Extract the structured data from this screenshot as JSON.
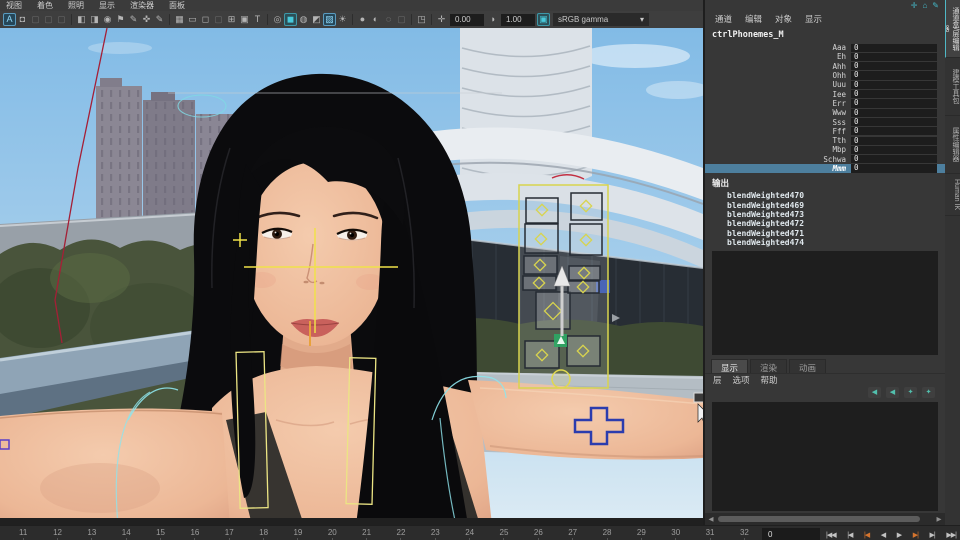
{
  "viewport_menu": {
    "items": [
      {
        "label": "视图"
      },
      {
        "label": "着色"
      },
      {
        "label": "照明"
      },
      {
        "label": "显示"
      },
      {
        "label": "渲染器"
      },
      {
        "label": "面板"
      }
    ]
  },
  "toolbar": {
    "icons": [
      {
        "name": "select-camera-icon",
        "glyph": "A",
        "active": true
      },
      {
        "name": "lock-camera-icon",
        "glyph": "◘"
      },
      {
        "name": "camera-attributes-icon",
        "glyph": "▢",
        "dim": true
      },
      {
        "name": "bookmark-slot-icon",
        "glyph": "▢",
        "dim": true
      },
      {
        "name": "image-plane-icon",
        "glyph": "▢",
        "dim": true
      },
      {
        "name": "separator",
        "glyph": "",
        "sep": true
      },
      {
        "name": "previous-view-icon",
        "glyph": "◧"
      },
      {
        "name": "next-view-icon",
        "glyph": "◨"
      },
      {
        "name": "camera-icon",
        "glyph": "◉"
      },
      {
        "name": "bookmark-icon",
        "glyph": "⚑"
      },
      {
        "name": "grease-pencil-icon",
        "glyph": "✎"
      },
      {
        "name": "rotate-view-icon",
        "glyph": "✜"
      },
      {
        "name": "draw-tool-icon",
        "glyph": "✎"
      },
      {
        "name": "separator",
        "glyph": "",
        "sep": true
      },
      {
        "name": "grid-icon",
        "glyph": "▦"
      },
      {
        "name": "film-gate-icon",
        "glyph": "▭"
      },
      {
        "name": "resolution-gate-icon",
        "glyph": "◻"
      },
      {
        "name": "gate-mask-icon",
        "glyph": "▢",
        "dim": true
      },
      {
        "name": "field-chart-icon",
        "glyph": "⊞"
      },
      {
        "name": "safe-action-icon",
        "glyph": "▣"
      },
      {
        "name": "safe-title-icon",
        "glyph": "T"
      },
      {
        "name": "separator",
        "glyph": "",
        "sep": true
      },
      {
        "name": "wireframe-icon",
        "glyph": "◎"
      },
      {
        "name": "shaded-icon",
        "glyph": "◼",
        "teal": true
      },
      {
        "name": "textured-icon",
        "glyph": "◍"
      },
      {
        "name": "use-default-material-icon",
        "glyph": "◩"
      },
      {
        "name": "xray-icon",
        "glyph": "▨",
        "active": true
      },
      {
        "name": "lighting-icon",
        "glyph": "☀"
      },
      {
        "name": "separator",
        "glyph": "",
        "sep": true
      },
      {
        "name": "shadows-icon",
        "glyph": "●"
      },
      {
        "name": "ambient-occlusion-icon",
        "glyph": "◐"
      },
      {
        "name": "motion-blur-icon",
        "glyph": "◌"
      },
      {
        "name": "plugin-slot-icon",
        "glyph": "▢",
        "dim": true
      },
      {
        "name": "separator",
        "glyph": "",
        "sep": true
      },
      {
        "name": "isolate-select-icon",
        "glyph": "◳"
      },
      {
        "name": "separator",
        "glyph": "",
        "sep": true
      },
      {
        "name": "exposure-icon",
        "glyph": "✛"
      }
    ],
    "exposure_value": "0.00",
    "gamma_icon": "◑",
    "gamma_value": "1.00",
    "view_transform_icon": "▣",
    "colorspace": "sRGB gamma",
    "dropdown_caret": "▾"
  },
  "header_icons": [
    {
      "name": "character-axis-icon",
      "glyph": "✛",
      "color": "#c65050"
    },
    {
      "name": "workspace-home-icon",
      "glyph": "⌂",
      "color": "#44b9c8"
    },
    {
      "name": "edit-mode-icon",
      "glyph": "✎",
      "color": "#44b9c8"
    }
  ],
  "channel_box": {
    "menu": [
      {
        "label": "通道"
      },
      {
        "label": "编辑"
      },
      {
        "label": "对象"
      },
      {
        "label": "显示"
      }
    ],
    "node_name": "ctrlPhonemes_M",
    "attributes": [
      {
        "name": "Aaa",
        "value": "0"
      },
      {
        "name": "Eh",
        "value": "0"
      },
      {
        "name": "Ahh",
        "value": "0"
      },
      {
        "name": "Ohh",
        "value": "0"
      },
      {
        "name": "Uuu",
        "value": "0"
      },
      {
        "name": "Iee",
        "value": "0"
      },
      {
        "name": "Err",
        "value": "0"
      },
      {
        "name": "Www",
        "value": "0"
      },
      {
        "name": "Sss",
        "value": "0"
      },
      {
        "name": "Fff",
        "value": "0"
      },
      {
        "name": "Tth",
        "value": "0"
      },
      {
        "name": "Mbp",
        "value": "0"
      },
      {
        "name": "Schwa",
        "value": "0"
      },
      {
        "name": "Mmm",
        "value": "0",
        "selected": true
      }
    ],
    "output_label": "输出",
    "outputs": [
      {
        "name": "blendWeighted470"
      },
      {
        "name": "blendWeighted469"
      },
      {
        "name": "blendWeighted473"
      },
      {
        "name": "blendWeighted472"
      },
      {
        "name": "blendWeighted471"
      },
      {
        "name": "blendWeighted474"
      }
    ]
  },
  "layer_editor": {
    "tabs": [
      {
        "label": "显示",
        "active": true
      },
      {
        "label": "渲染"
      },
      {
        "label": "动画"
      }
    ],
    "menu": [
      {
        "label": "层"
      },
      {
        "label": "选项"
      },
      {
        "label": "帮助"
      }
    ],
    "icon_buttons": [
      {
        "name": "layer-move-icon-1",
        "glyph": "◀"
      },
      {
        "name": "layer-move-icon-2",
        "glyph": "◀"
      },
      {
        "name": "layer-paint-icon",
        "glyph": "✦"
      },
      {
        "name": "layer-new-icon",
        "glyph": "✦"
      }
    ]
  },
  "sidebar_tabs": [
    {
      "label": "通道盒/层编辑器",
      "active": true
    },
    {
      "label": "建模工具包"
    },
    {
      "label": "属性编辑器"
    },
    {
      "label": "Human IK"
    }
  ],
  "timeline": {
    "frames": [
      {
        "n": "11"
      },
      {
        "n": "12"
      },
      {
        "n": "13"
      },
      {
        "n": "14"
      },
      {
        "n": "15"
      },
      {
        "n": "16"
      },
      {
        "n": "17"
      },
      {
        "n": "18"
      },
      {
        "n": "19"
      },
      {
        "n": "20"
      },
      {
        "n": "21"
      },
      {
        "n": "22"
      },
      {
        "n": "23"
      },
      {
        "n": "24"
      },
      {
        "n": "25"
      },
      {
        "n": "26"
      },
      {
        "n": "27"
      },
      {
        "n": "28"
      },
      {
        "n": "29"
      },
      {
        "n": "30"
      },
      {
        "n": "31"
      },
      {
        "n": "32"
      }
    ],
    "current_frame": "0",
    "playback": [
      {
        "name": "go-to-start-button",
        "glyph": "|◀◀"
      },
      {
        "name": "step-back-frame-button",
        "glyph": "|◀"
      },
      {
        "name": "step-back-key-button",
        "glyph": "|◀",
        "accent": true
      },
      {
        "name": "play-backward-button",
        "glyph": "◀"
      },
      {
        "name": "play-forward-button",
        "glyph": "▶"
      },
      {
        "name": "step-forward-key-button",
        "glyph": "▶|",
        "accent": true
      },
      {
        "name": "step-forward-frame-button",
        "glyph": "▶|"
      },
      {
        "name": "go-to-end-button",
        "glyph": "▶▶|"
      }
    ]
  },
  "colors": {
    "selection_highlight": "#4d7f9e",
    "rig_yellow": "#e8df5e",
    "rig_cyan": "#8ee4ec",
    "rig_red": "#a51f36",
    "rig_blue": "#2b3cae",
    "accent_teal": "#44b9c8"
  }
}
